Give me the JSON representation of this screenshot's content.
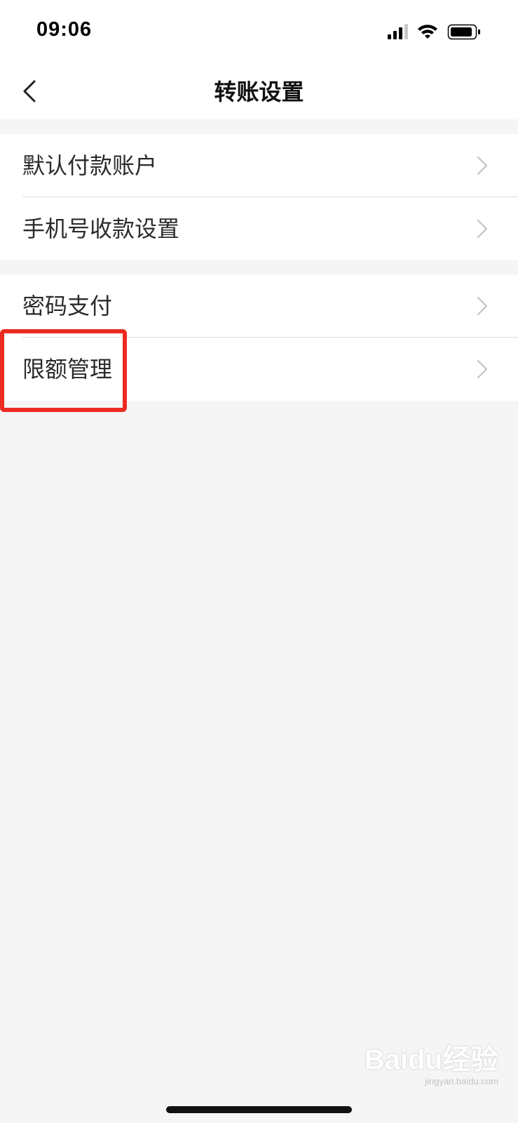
{
  "status_bar": {
    "time": "09:06",
    "icons": [
      "cellular-signal-icon",
      "wifi-icon",
      "battery-icon"
    ]
  },
  "nav": {
    "title": "转账设置",
    "back_icon": "chevron-left-icon"
  },
  "groups": [
    {
      "items": [
        {
          "label": "默认付款账户",
          "icon": "chevron-right-icon"
        },
        {
          "label": "手机号收款设置",
          "icon": "chevron-right-icon"
        }
      ]
    },
    {
      "items": [
        {
          "label": "密码支付",
          "icon": "chevron-right-icon"
        },
        {
          "label": "限额管理",
          "icon": "chevron-right-icon",
          "highlighted": true
        }
      ]
    }
  ],
  "highlight_color": "#ec2b22",
  "watermark": {
    "main": "Baidu经验",
    "sub": "jingyan.baidu.com"
  }
}
